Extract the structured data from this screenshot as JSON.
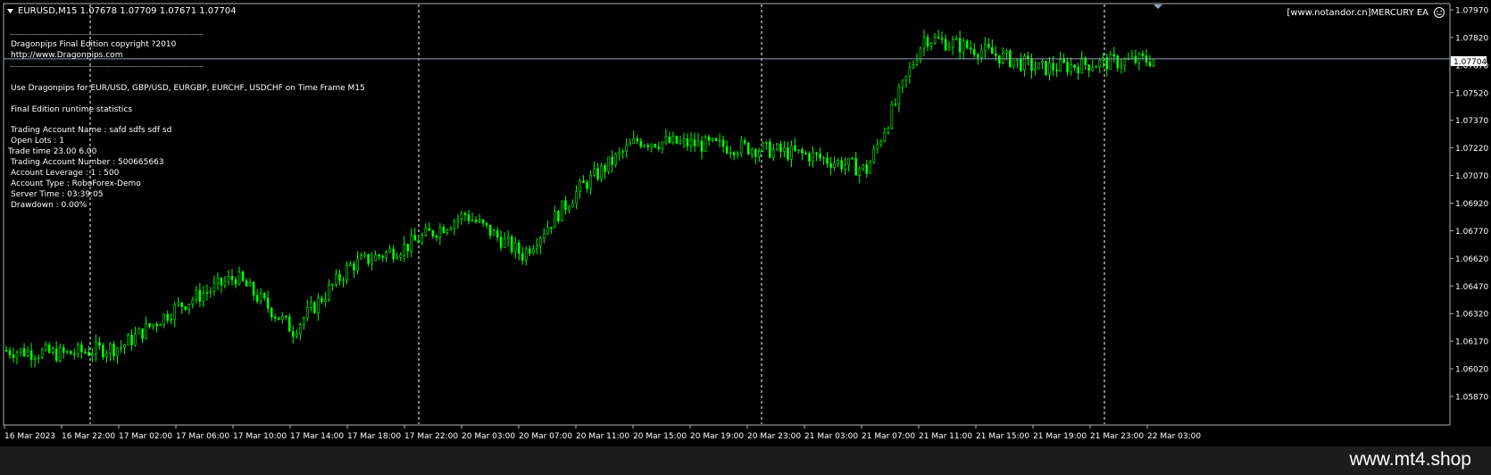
{
  "header": {
    "symbol_line": "EURUSD,M15  1.07678 1.07709 1.07671 1.07704",
    "ea_label": "[www.notandor.cn]MERCURY EA",
    "smiley_icon": "smiley-face-icon"
  },
  "overlay": {
    "separator": "----------------------------------------------------------------------------------------------------",
    "lines": [
      "Dragonpips Final Edition copyright ?2010",
      "http://www.Dragonpips.com",
      "Use Dragonpips for EUR/USD, GBP/USD, EURGBP, EURCHF, USDCHF on Time Frame M15",
      "Final Edition runtime statistics",
      "Trading Account Name  : safd    sdfs sdf  sd",
      "Open Lots  : 1",
      "Trade time 23.00 6.00",
      "Trading Account Number  : 500665663",
      "Account Leverage  :  1 : 500",
      "Account Type  :  RoboForex-Demo",
      "Server Time  :  03:39:05",
      "Drawdown  :  0.00%"
    ]
  },
  "price_axis": {
    "ticks": [
      "1.07970",
      "1.07820",
      "1.07670",
      "1.07520",
      "1.07370",
      "1.07220",
      "1.07070",
      "1.06920",
      "1.06770",
      "1.06620",
      "1.06470",
      "1.06320",
      "1.06170",
      "1.06020",
      "1.05870"
    ],
    "current_price_label": "1.07704"
  },
  "time_axis": {
    "labels": [
      "16 Mar 2023",
      "16 Mar 22:00",
      "17 Mar 02:00",
      "17 Mar 06:00",
      "17 Mar 10:00",
      "17 Mar 14:00",
      "17 Mar 18:00",
      "17 Mar 22:00",
      "20 Mar 03:00",
      "20 Mar 07:00",
      "20 Mar 11:00",
      "20 Mar 15:00",
      "20 Mar 19:00",
      "20 Mar 23:00",
      "21 Mar 03:00",
      "21 Mar 07:00",
      "21 Mar 11:00",
      "21 Mar 15:00",
      "21 Mar 19:00",
      "21 Mar 23:00",
      "22 Mar 03:00"
    ]
  },
  "footer": {
    "watermark": "www.mt4.shop"
  },
  "colors": {
    "background": "#000000",
    "candle": "#00ff00",
    "axis_text": "#ffffff",
    "price_line": "#8fa3b8",
    "grid_dashed": "#ffffff",
    "label_box_bg": "#ffffff",
    "label_box_text": "#000000"
  },
  "chart_data": {
    "type": "candlestick",
    "symbol": "EURUSD",
    "timeframe": "M15",
    "ylim": [
      1.058,
      1.08
    ],
    "current_price": 1.07704,
    "ohlc_last": {
      "open": 1.07678,
      "high": 1.07709,
      "low": 1.07671,
      "close": 1.07704
    },
    "x": [
      "16 Mar 2023",
      "16 Mar 22:00",
      "17 Mar 02:00",
      "17 Mar 06:00",
      "17 Mar 10:00",
      "17 Mar 14:00",
      "17 Mar 18:00",
      "17 Mar 22:00",
      "20 Mar 03:00",
      "20 Mar 07:00",
      "20 Mar 11:00",
      "20 Mar 15:00",
      "20 Mar 19:00",
      "20 Mar 23:00",
      "21 Mar 03:00",
      "21 Mar 07:00",
      "21 Mar 11:00",
      "21 Mar 15:00",
      "21 Mar 19:00",
      "21 Mar 23:00",
      "22 Mar 03:00"
    ],
    "close_values": [
      1.0612,
      1.061,
      1.0614,
      1.0636,
      1.0652,
      1.0623,
      1.0658,
      1.0669,
      1.0686,
      1.0664,
      1.07,
      1.0726,
      1.0724,
      1.0722,
      1.0718,
      1.071,
      1.0782,
      1.0775,
      1.0765,
      1.0768,
      1.077
    ],
    "grid": false,
    "legend": "none"
  }
}
